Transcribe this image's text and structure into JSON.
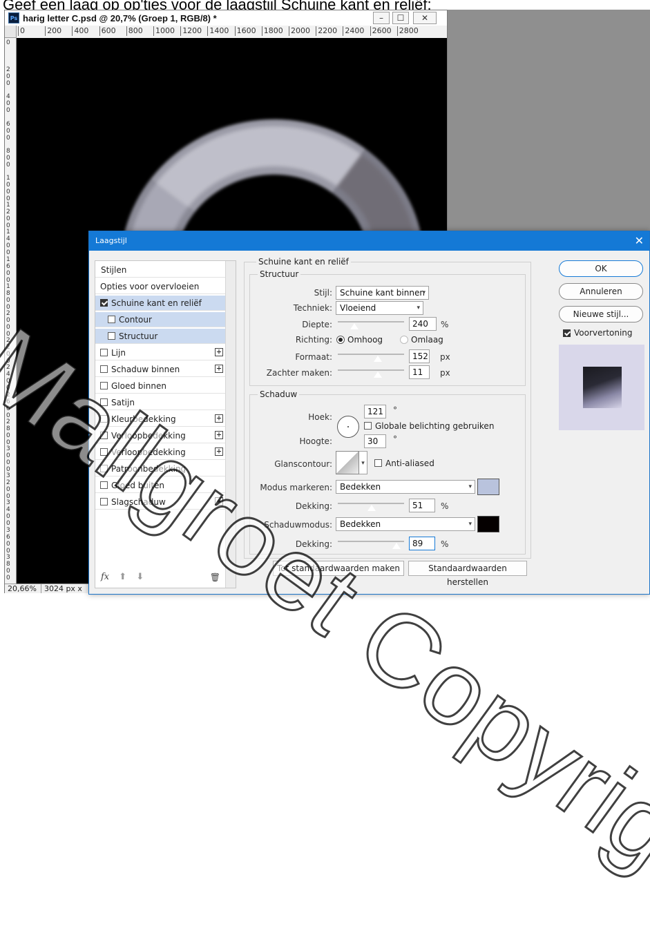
{
  "caption": "Geef een laag op op'tjes voor de laagstijl Schuine kant en reliëf:",
  "doc": {
    "title": "harig letter C.psd @ 20,7% (Groep 1, RGB/8) *",
    "app_icon": "Ps",
    "minimize": "–",
    "maximize": "☐",
    "close": "✕",
    "ruler_top": [
      "0",
      "200",
      "400",
      "600",
      "800",
      "1000",
      "1200",
      "1400",
      "1600",
      "1800",
      "2000",
      "2200",
      "2400",
      "2600",
      "2800"
    ],
    "ruler_left": [
      "0",
      "2\n0\n0",
      "4\n0\n0",
      "6\n0\n0",
      "8\n0\n0",
      "1\n0\n0\n0",
      "1\n2\n0\n0",
      "1\n4\n0\n0",
      "1\n6\n0\n0",
      "1\n8\n0\n0",
      "2\n0\n0\n0",
      "2\n2\n0\n0",
      "2\n4\n0\n0",
      "2\n6\n0\n0",
      "2\n8\n0\n0",
      "3\n0\n0\n0",
      "3\n2\n0\n0",
      "3\n4\n0\n0",
      "3\n6\n0\n0",
      "3\n8\n0\n0"
    ],
    "zoom": "20,66%",
    "doc_size": "3024 px x"
  },
  "dialog": {
    "title": "Laagstijl",
    "close": "✕",
    "style_list": {
      "header": "Stijlen",
      "items": [
        {
          "label": "Opties voor overvloeien",
          "checkbox": false,
          "plus": false
        },
        {
          "label": "Schuine kant en reliëf",
          "checkbox": true,
          "checked": true,
          "plus": false
        },
        {
          "label": "Contour",
          "checkbox": true,
          "checked": false,
          "plus": false
        },
        {
          "label": "Structuur",
          "checkbox": true,
          "checked": false,
          "plus": false
        },
        {
          "label": "Lijn",
          "checkbox": true,
          "checked": false,
          "plus": true
        },
        {
          "label": "Schaduw binnen",
          "checkbox": true,
          "checked": false,
          "plus": true
        },
        {
          "label": "Gloed binnen",
          "checkbox": true,
          "checked": false,
          "plus": false
        },
        {
          "label": "Satijn",
          "checkbox": true,
          "checked": false,
          "plus": false
        },
        {
          "label": "Kleurbedekking",
          "checkbox": true,
          "checked": false,
          "plus": true
        },
        {
          "label": "Verloopbedekking",
          "checkbox": true,
          "checked": false,
          "plus": true
        },
        {
          "label": "Verloopbedekking",
          "checkbox": true,
          "checked": false,
          "plus": true
        },
        {
          "label": "Patroonbedekking",
          "checkbox": true,
          "checked": false,
          "plus": false
        },
        {
          "label": "Gloed buiten",
          "checkbox": true,
          "checked": false,
          "plus": false
        },
        {
          "label": "Slagschaduw",
          "checkbox": true,
          "checked": false,
          "plus": true
        }
      ],
      "footer_fx": "fx",
      "footer_up": "⬆",
      "footer_down": "⬇",
      "footer_trash": "🗑"
    },
    "bevel": {
      "section_title": "Schuine kant en reliëf",
      "structure": {
        "title": "Structuur",
        "style_label": "Stijl:",
        "style_value": "Schuine kant binnen",
        "technique_label": "Techniek:",
        "technique_value": "Vloeiend",
        "depth_label": "Diepte:",
        "depth_value": "240",
        "depth_unit": "%",
        "depth_slider": 0.25,
        "direction_label": "Richting:",
        "direction_up": "Omhoog",
        "direction_down": "Omlaag",
        "size_label": "Formaat:",
        "size_value": "152",
        "size_unit": "px",
        "size_slider": 0.6,
        "soften_label": "Zachter maken:",
        "soften_value": "11",
        "soften_unit": "px",
        "soften_slider": 0.6
      },
      "shading": {
        "title": "Schaduw",
        "angle_label": "Hoek:",
        "angle_value": "121",
        "angle_unit": "°",
        "global_light_label": "Globale belichting gebruiken",
        "altitude_label": "Hoogte:",
        "altitude_value": "30",
        "altitude_unit": "°",
        "gloss_label": "Glanscontour:",
        "antialias_label": "Anti-aliased",
        "highlight_mode_label": "Modus markeren:",
        "highlight_mode_value": "Bedekken",
        "highlight_color": "#b9c3dd",
        "highlight_opacity_label": "Dekking:",
        "highlight_opacity_value": "51",
        "highlight_opacity_unit": "%",
        "highlight_opacity_slider": 0.51,
        "shadow_mode_label": "Schaduwmodus:",
        "shadow_mode_value": "Bedekken",
        "shadow_color": "#050000",
        "shadow_opacity_label": "Dekking:",
        "shadow_opacity_value": "89",
        "shadow_opacity_unit": "%",
        "shadow_opacity_slider": 0.89
      },
      "btn_make_default": "Tot standaardwaarden maken",
      "btn_reset_default": "Standaardwaarden herstellen"
    },
    "right": {
      "ok": "OK",
      "cancel": "Annuleren",
      "new_style": "Nieuwe stijl...",
      "preview_label": "Voorvertoning"
    }
  },
  "watermark": "Mallgroet Copyright"
}
